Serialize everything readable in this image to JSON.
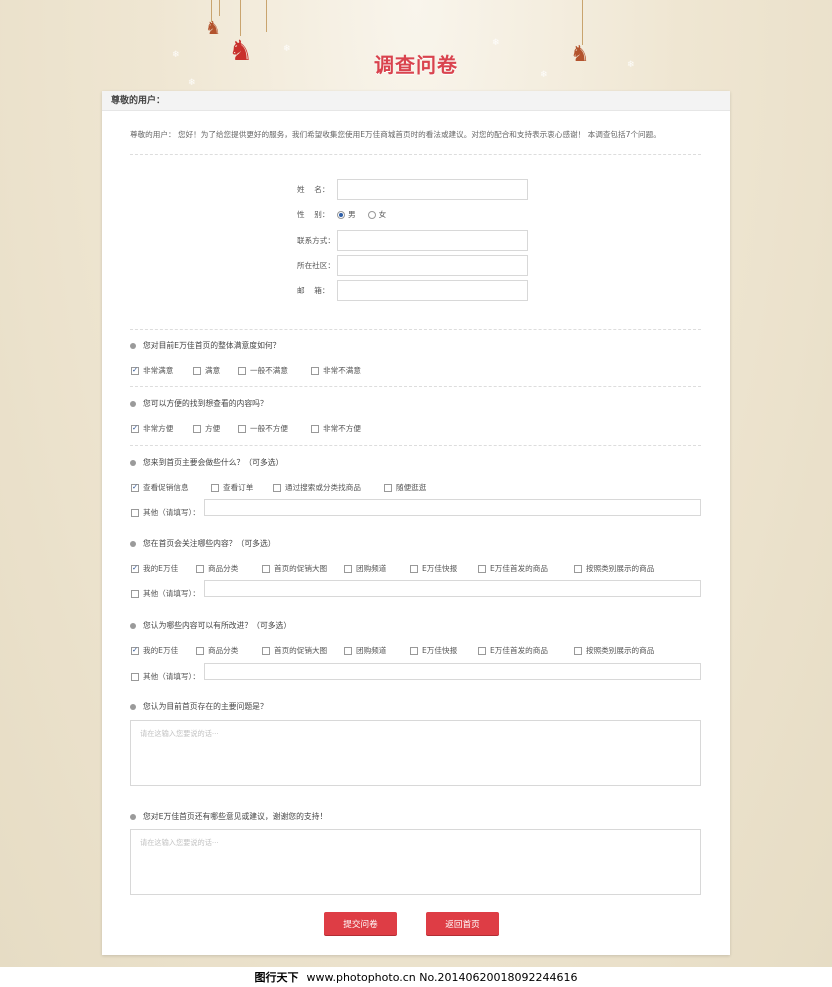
{
  "page": {
    "title": "调查问卷"
  },
  "card": {
    "heading": "尊敬的用户：",
    "intro": "尊敬的用户：  您好！为了给您提供更好的服务，我们希望收集您使用E万佳商城首页时的看法或建议。对您的配合和支持表示衷心感谢！  本调查包括7个问题。"
  },
  "form": {
    "name_label": "姓    名：",
    "gender_label": "性    别：",
    "gender_options": [
      "男",
      "女"
    ],
    "gender_selected": "男",
    "contact_label": "联系方式：",
    "community_label": "所在社区：",
    "email_label": "邮    箱："
  },
  "questions": [
    {
      "text": "您对目前E万佳首页的整体满意度如何？",
      "options": [
        "非常满意",
        "满意",
        "一般不满意",
        "非常不满意"
      ],
      "checked": [
        0
      ]
    },
    {
      "text": "您可以方便的找到想查看的内容吗？",
      "options": [
        "非常方便",
        "方便",
        "一般不方便",
        "非常不方便"
      ],
      "checked": [
        0
      ]
    },
    {
      "text": "您来到首页主要会做些什么？（可多选）",
      "options": [
        "查看促销信息",
        "查看订单",
        "通过搜索或分类找商品",
        "随便逛逛"
      ],
      "checked": [
        0
      ],
      "other_label": "其他（请填写）："
    },
    {
      "text": "您在首页会关注哪些内容？（可多选）",
      "options": [
        "我的E万佳",
        "商品分类",
        "首页的促销大图",
        "团购频道",
        "E万佳快报",
        "E万佳首发的商品",
        "按照类别展示的商品"
      ],
      "checked": [
        0
      ],
      "other_label": "其他（请填写）："
    },
    {
      "text": "您认为哪些内容可以有所改进？（可多选）",
      "options": [
        "我的E万佳",
        "商品分类",
        "首页的促销大图",
        "团购频道",
        "E万佳快报",
        "E万佳首发的商品",
        "按照类别展示的商品"
      ],
      "checked": [
        0
      ],
      "other_label": "其他（请填写）："
    },
    {
      "text": "您认为目前首页存在的主要问题是？",
      "placeholder": "请在这输入您要说的话···"
    },
    {
      "text": "您对E万佳首页还有哪些意见或建议，谢谢您的支持！",
      "placeholder": "请在这输入您要说的话···"
    }
  ],
  "buttons": {
    "submit": "提交问卷",
    "back": "返回首页"
  },
  "footer": {
    "watermark": "图行天下",
    "text": "www.photophoto.cn  No.20140620018092244616"
  }
}
